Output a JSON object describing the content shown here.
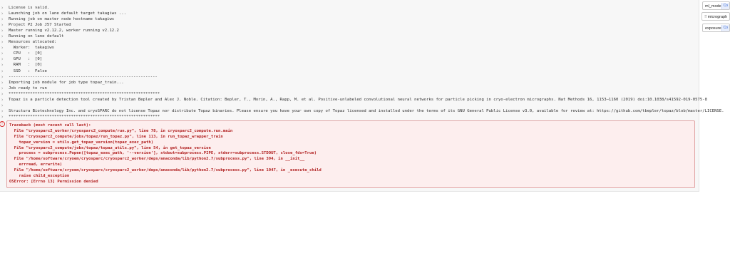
{
  "log": {
    "lines": [
      "License is valid.",
      "Launching job on lane default target takagiws ...",
      "Running job on master node hostname takagiws",
      "Project P2 Job J57 Started",
      "Master running v2.12.2, worker running v2.12.2",
      "Running on lane default",
      "Resources allocated:",
      "  Worker:  takagiws",
      "  CPU   :  [0]",
      "  GPU   :  [0]",
      "  RAM   :  [0]",
      "  SSD   :  False",
      "--------------------------------------------------------------",
      "Importing job module for job type topaz_train...",
      "Job ready to run",
      "***************************************************************",
      "Topaz is a particle detection tool created by Tristan Bepler and Alex J. Noble. Citation: Bepler, T., Morin, A., Rapp, M. et al. Positive-unlabeled convolutional neural networks for particle picking in cryo-electron micrographs. Nat Methods 16, 1153–1160 (2019) doi:10.1038/s41592-019-0575-8",
      "",
      "Structura Biotechnology Inc. and cryoSPARC do not license Topaz nor distribute Topaz binaries. Please ensure you have your own copy of Topaz licensed and installed under the terms of its GNU General Public License v3.0, available for review at: https://github.com/tbepler/topaz/blob/master/LICENSE.",
      "***************************************************************"
    ],
    "error_lines": [
      "Traceback (most recent call last):",
      "  File \"cryosparc2_worker/cryosparc2_compute/run.py\", line 78, in cryosparc2_compute.run.main",
      "  File \"cryosparc2_compute/jobs/topaz/run_topaz.py\", line 113, in run_topaz_wrapper_train",
      "    topaz_version = utils.get_topaz_version(topaz_exec_path)",
      "  File \"cryosparc2_compute/jobs/topaz/topaz_utils.py\", line 54, in get_topaz_version",
      "    process = subprocess.Popen([topaz_exec_path, '--version'], stdout=subprocess.PIPE, stderr=subprocess.STDOUT, close_fds=True)",
      "  File \"/home/software/cryoem/cryosparc/cryosparc2_worker/deps/anaconda/lib/python2.7/subprocess.py\", line 394, in __init__",
      "    errread, errwrite)",
      "  File \"/home/software/cryoem/cryosparc/cryosparc2_worker/deps/anaconda/lib/python2.7/subprocess.py\", line 1047, in _execute_child",
      "    raise child_exception",
      "OSError: [Errno 13] Permission denied"
    ]
  },
  "sidebar": {
    "inputs": [
      {
        "label": "ml_model",
        "tag": "Co"
      },
      {
        "label": "micrograph",
        "tag": ""
      },
      {
        "label": "exposure",
        "tag": "Co"
      }
    ]
  }
}
